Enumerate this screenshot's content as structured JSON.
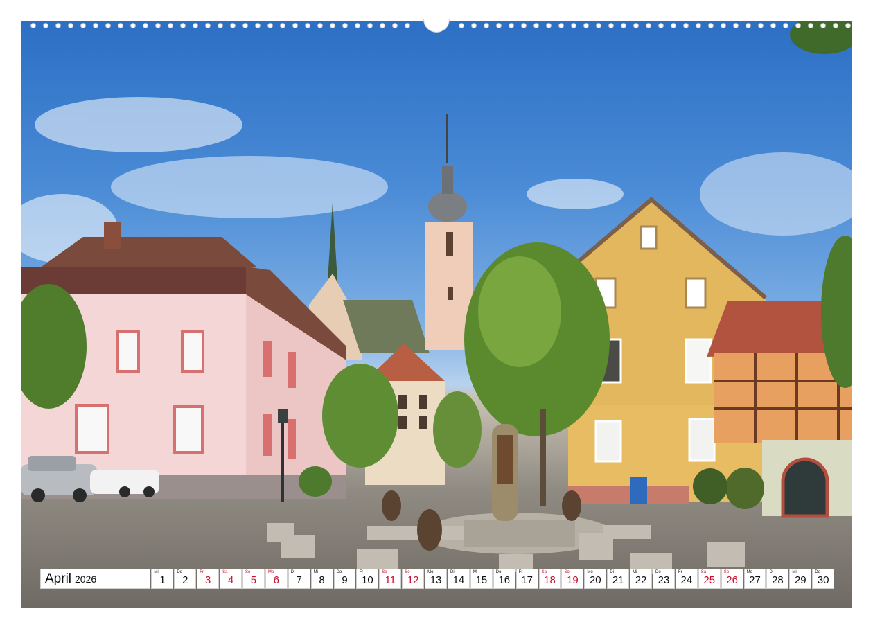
{
  "calendar": {
    "month": "April",
    "year": "2026",
    "days": [
      {
        "wd": "Mi",
        "num": "1",
        "red": false
      },
      {
        "wd": "Do",
        "num": "2",
        "red": false
      },
      {
        "wd": "Fr",
        "num": "3",
        "red": true
      },
      {
        "wd": "Sa",
        "num": "4",
        "red": true
      },
      {
        "wd": "So",
        "num": "5",
        "red": true
      },
      {
        "wd": "Mo",
        "num": "6",
        "red": true
      },
      {
        "wd": "Di",
        "num": "7",
        "red": false
      },
      {
        "wd": "Mi",
        "num": "8",
        "red": false
      },
      {
        "wd": "Do",
        "num": "9",
        "red": false
      },
      {
        "wd": "Fr",
        "num": "10",
        "red": false
      },
      {
        "wd": "Sa",
        "num": "11",
        "red": true
      },
      {
        "wd": "So",
        "num": "12",
        "red": true
      },
      {
        "wd": "Mo",
        "num": "13",
        "red": false
      },
      {
        "wd": "Di",
        "num": "14",
        "red": false
      },
      {
        "wd": "Mi",
        "num": "15",
        "red": false
      },
      {
        "wd": "Do",
        "num": "16",
        "red": false
      },
      {
        "wd": "Fr",
        "num": "17",
        "red": false
      },
      {
        "wd": "Sa",
        "num": "18",
        "red": true
      },
      {
        "wd": "So",
        "num": "19",
        "red": true
      },
      {
        "wd": "Mo",
        "num": "20",
        "red": false
      },
      {
        "wd": "Di",
        "num": "21",
        "red": false
      },
      {
        "wd": "Mi",
        "num": "22",
        "red": false
      },
      {
        "wd": "Do",
        "num": "23",
        "red": false
      },
      {
        "wd": "Fr",
        "num": "24",
        "red": false
      },
      {
        "wd": "Sa",
        "num": "25",
        "red": true
      },
      {
        "wd": "So",
        "num": "26",
        "red": true
      },
      {
        "wd": "Mo",
        "num": "27",
        "red": false
      },
      {
        "wd": "Di",
        "num": "28",
        "red": false
      },
      {
        "wd": "Mi",
        "num": "29",
        "red": false
      },
      {
        "wd": "Do",
        "num": "30",
        "red": false
      }
    ]
  },
  "colors": {
    "weekend_red": "#c8102e",
    "sky": "#3b7fd0",
    "pink_facade": "#f1d3d3",
    "yellow_facade": "#e1b35a",
    "cobblestone": "#8a857d"
  }
}
